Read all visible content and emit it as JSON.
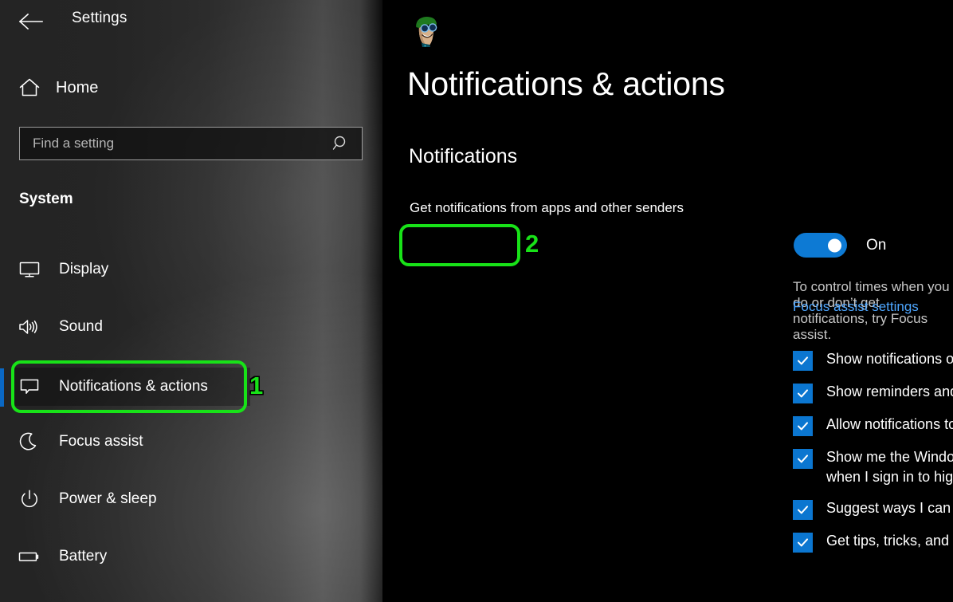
{
  "window": {
    "title": "Settings",
    "back_icon": "back-arrow-icon"
  },
  "sidebar": {
    "home": {
      "label": "Home",
      "icon": "home-icon"
    },
    "search": {
      "placeholder": "Find a setting",
      "value": "",
      "icon": "search-icon"
    },
    "group_heading": "System",
    "items": [
      {
        "label": "Display",
        "icon": "monitor-icon",
        "selected": false
      },
      {
        "label": "Sound",
        "icon": "speaker-icon",
        "selected": false
      },
      {
        "label": "Notifications & actions",
        "icon": "speech-bubble-icon",
        "selected": true
      },
      {
        "label": "Focus assist",
        "icon": "moon-icon",
        "selected": false
      },
      {
        "label": "Power & sleep",
        "icon": "power-icon",
        "selected": false
      },
      {
        "label": "Battery",
        "icon": "battery-icon",
        "selected": false
      }
    ]
  },
  "main": {
    "avatar_icon": "user-avatar-cartoon",
    "page_title": "Notifications & actions",
    "section_heading": "Notifications",
    "toggle": {
      "label": "Get notifications from apps and other senders",
      "state": "On",
      "on": true,
      "accent_color": "#0d7ad4"
    },
    "focus_description": "To control times when you do or don’t get notifications, try Focus assist.",
    "focus_link": "Focus assist settings",
    "link_color": "#4da6ff",
    "checkboxes": [
      {
        "label": "Show notifications on the lock screen",
        "checked": true
      },
      {
        "label": "Show reminders and incoming VoIP calls on the lock screen",
        "checked": true
      },
      {
        "label": "Allow notifications to play sounds",
        "checked": true
      },
      {
        "label": "Show me the Windows welcome experience after updates and occasionally when I sign in to highlight what’s new and suggested",
        "checked": true
      },
      {
        "label": "Suggest ways I can finish setting up my device to get the most out of Windows",
        "checked": true
      },
      {
        "label": "Get tips, tricks, and suggestions as you use Windows",
        "checked": true
      }
    ]
  },
  "annotations": {
    "color": "#18e218",
    "markers": [
      {
        "number": "1",
        "target": "sidebar-item-notifications-actions"
      },
      {
        "number": "2",
        "target": "notifications-toggle"
      }
    ]
  }
}
